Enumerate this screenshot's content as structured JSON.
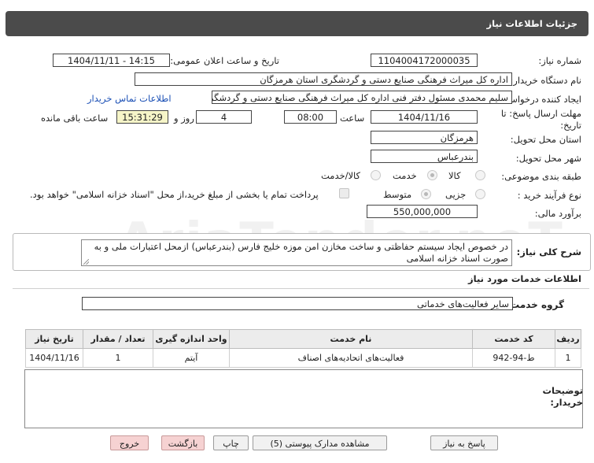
{
  "header": {
    "title": "جزئیات اطلاعات نیاز"
  },
  "need_number": {
    "label": "شماره نیاز:",
    "value": "1104004172000035"
  },
  "announce": {
    "label": "تاریخ و ساعت اعلان عمومی:",
    "value": "1404/11/11 - 14:15"
  },
  "buyer_org": {
    "label": "نام دستگاه خریدار:",
    "value": "اداره کل میراث فرهنگی  صنایع دستی و گردشگری استان هرمزگان"
  },
  "requester": {
    "label": "ایجاد کننده درخواست:",
    "value": "سلیم محمدی مسئول دفتر فنی اداره کل میراث فرهنگی  صنایع دستی و گردشگری",
    "contact_link": "اطلاعات تماس خریدار"
  },
  "deadline": {
    "label_line1": "مهلت ارسال پاسخ: تا",
    "label_line2": "تاریخ:",
    "date": "1404/11/16",
    "time_label": "ساعت",
    "time": "08:00",
    "days": "4",
    "days_label": "روز و",
    "remaining": "15:31:29",
    "remaining_label": "ساعت باقی مانده"
  },
  "province": {
    "label": "استان محل تحویل:",
    "value": "هرمزگان"
  },
  "city": {
    "label": "شهر محل تحویل:",
    "value": "بندرعباس"
  },
  "category": {
    "label": "طبقه بندی موضوعی:",
    "options": [
      "کالا",
      "خدمت",
      "کالا/خدمت"
    ],
    "selected": "خدمت"
  },
  "process": {
    "label": "نوع فرآیند خرید :",
    "options": [
      "جزیی",
      "متوسط"
    ],
    "selected": "متوسط",
    "payment_note": "پرداخت تمام یا بخشی از مبلغ خرید،از محل \"اسناد خزانه اسلامی\" خواهد بود."
  },
  "budget": {
    "label": "برآورد مالی:",
    "value": "550,000,000"
  },
  "description": {
    "label": "شرح کلی نیاز:",
    "value": "در خصوص ایجاد سیستم حفاظتی و ساخت مخازن امن موزه خلیج فارس (بندرعباس) ازمحل اعتبارات ملی و به صورت اسناد خزانه اسلامی"
  },
  "services": {
    "title": "اطلاعات خدمات مورد نیاز",
    "group_label": "گروه خدمت:",
    "group_value": "سایر فعالیت‌های خدماتی"
  },
  "table": {
    "headers": [
      "ردیف",
      "کد خدمت",
      "نام خدمت",
      "واحد اندازه گیری",
      "تعداد / مقدار",
      "تاریخ نیاز"
    ],
    "rows": [
      [
        "1",
        "ط-94-942",
        "فعالیت‌های اتحادیه‌های اصناف",
        "آیتم",
        "1",
        "1404/11/16"
      ]
    ]
  },
  "buyer_notes": {
    "label_line1": "توضیحات",
    "label_line2": "خریدار:",
    "value": ""
  },
  "buttons": {
    "reply": "پاسخ به نیاز",
    "docs": "مشاهده مدارک پیوستی (5)",
    "print": "چاپ",
    "back": "بازگشت",
    "exit": "خروج"
  },
  "watermark": "AriaTender.neT"
}
